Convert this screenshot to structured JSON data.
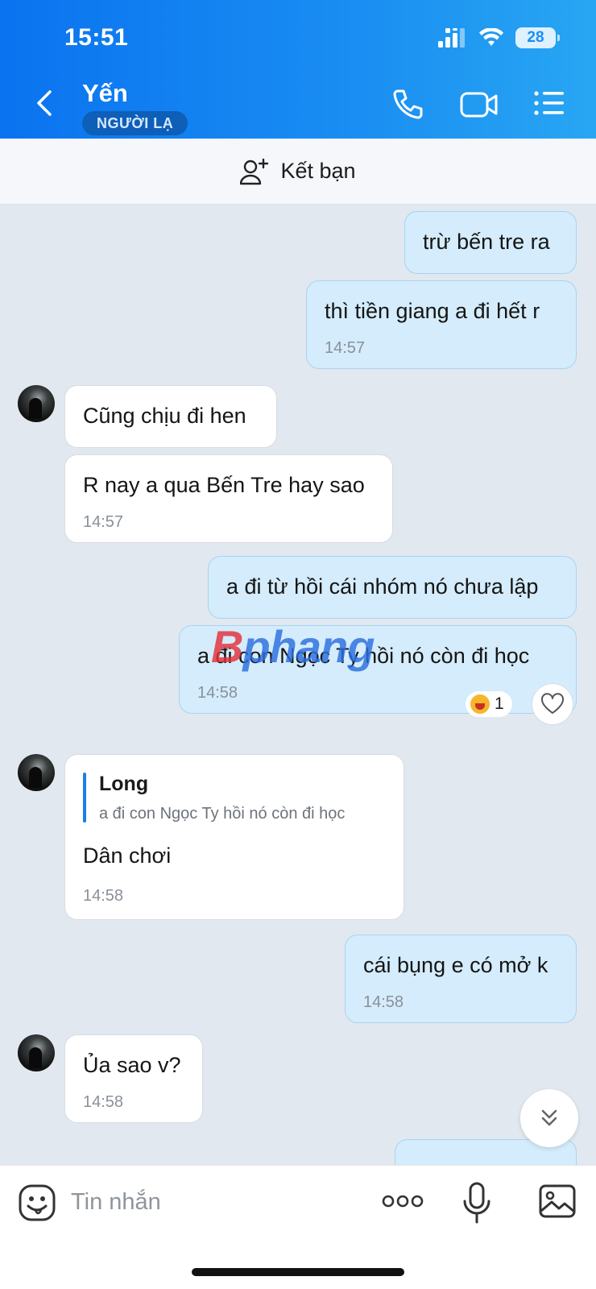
{
  "status_bar": {
    "time": "15:51",
    "battery": "28"
  },
  "header": {
    "contact_name": "Yến",
    "badge": "NGƯỜI LẠ"
  },
  "add_friend": {
    "label": "Kết bạn"
  },
  "messages": [
    {
      "text": "trừ bến tre ra"
    },
    {
      "text": "thì tiền giang a đi hết r",
      "time": "14:57"
    },
    {
      "text": "Cũng chịu đi hen"
    },
    {
      "text": "R nay a qua Bến Tre hay sao",
      "time": "14:57"
    },
    {
      "text": "a đi từ hồi cái nhóm nó chưa lập"
    },
    {
      "text": "a đi con Ngọc Ty hồi nó còn đi học",
      "time": "14:58",
      "reaction_count": "1"
    },
    {
      "quote_name": "Long",
      "quote_text": "a đi con Ngọc Ty hồi nó còn đi học",
      "text": "Dân chơi",
      "time": "14:58"
    },
    {
      "text": "cái bụng e có mở k",
      "time": "14:58"
    },
    {
      "text": "Ủa sao v?",
      "time": "14:58"
    }
  ],
  "input": {
    "placeholder": "Tin nhắn"
  },
  "watermark": {
    "first": "B",
    "rest": "phang"
  },
  "icons": [
    "back-icon",
    "phone-icon",
    "video-call-icon",
    "menu-list-icon",
    "add-friend-icon",
    "heart-icon",
    "scroll-down-icon",
    "sticker-icon",
    "more-icon",
    "microphone-icon",
    "image-icon"
  ],
  "colors": {
    "header_start": "#0a73f0",
    "header_end": "#28a6f3",
    "outgoing_bubble": "#d4ecfb",
    "incoming_bubble": "#ffffff",
    "chat_background": "#e2e8f0"
  }
}
